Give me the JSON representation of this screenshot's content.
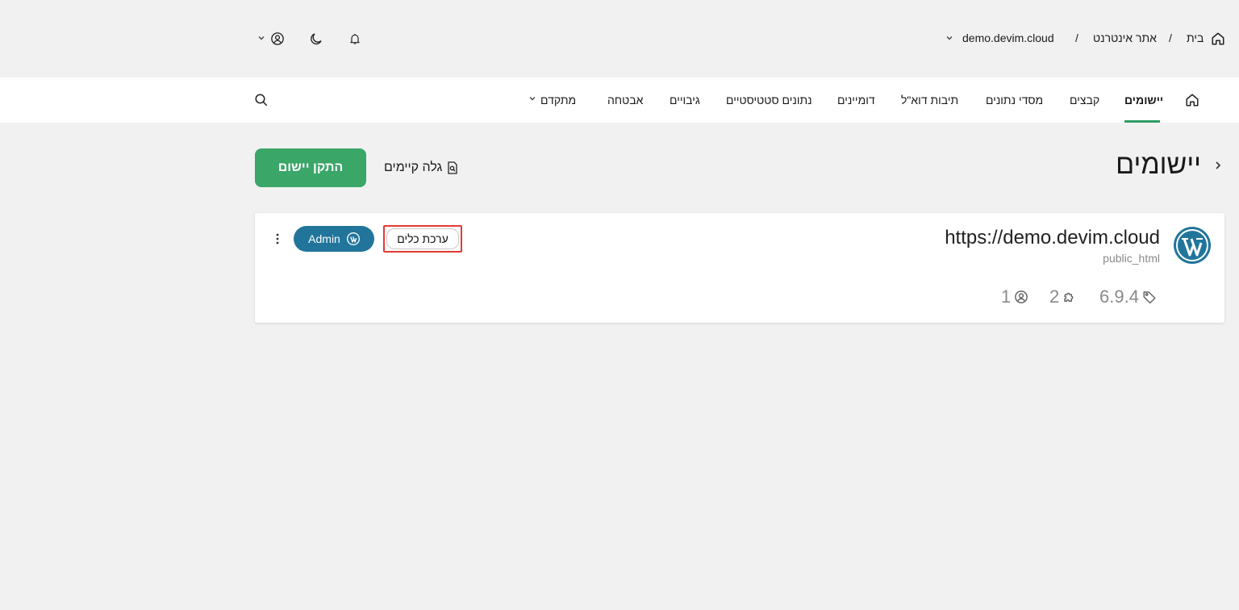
{
  "breadcrumb": {
    "home_label": "בית",
    "separator": "/",
    "section": "אתר אינטרנט",
    "domain": "demo.devim.cloud"
  },
  "nav": {
    "items": [
      {
        "label": "יישומים",
        "active": true
      },
      {
        "label": "קבצים"
      },
      {
        "label": "מסדי נתונים"
      },
      {
        "label": "תיבות דוא\"ל"
      },
      {
        "label": "דומיינים"
      },
      {
        "label": "נתונים סטטיסטיים"
      },
      {
        "label": "גיבויים"
      },
      {
        "label": "אבטחה"
      },
      {
        "label": "מתקדם"
      }
    ]
  },
  "page": {
    "title": "יישומים",
    "discover_label": "גלה קיימים",
    "install_label": "התקן יישום"
  },
  "app": {
    "url": "https://demo.devim.cloud",
    "path": "public_html",
    "version": "6.9.4",
    "plugins": "2",
    "users": "1",
    "toolkit_label": "ערכת כלים",
    "admin_label": "Admin"
  },
  "colors": {
    "accent_green": "#3aa668",
    "wordpress_blue": "#21759b",
    "highlight_red": "#e53935"
  },
  "icons": [
    "home-icon",
    "chevron-down-icon",
    "bell-icon",
    "moon-icon",
    "user-circle-icon",
    "search-icon",
    "chevron-right-icon",
    "document-search-icon",
    "wordpress-logo-icon",
    "tag-icon",
    "puzzle-icon",
    "kebab-icon"
  ]
}
